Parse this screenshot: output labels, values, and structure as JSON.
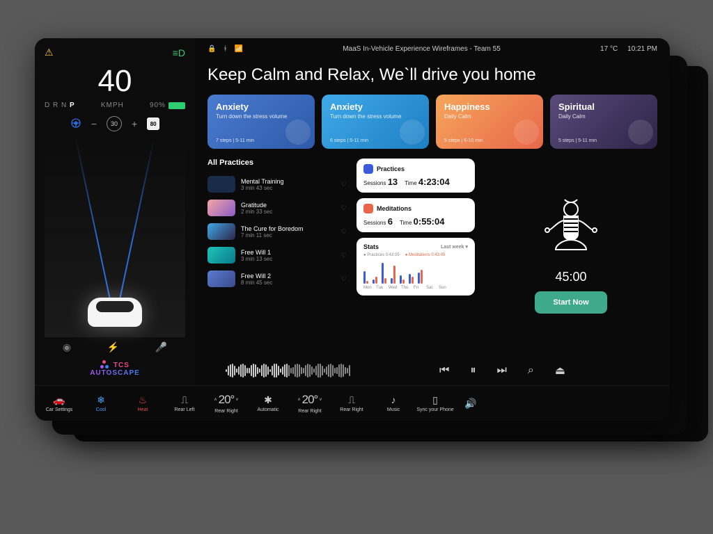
{
  "status": {
    "title": "MaaS  In-Vehicle Experience Wireframes - Team 55",
    "temp": "17 °C",
    "time": "10:21 PM",
    "time2": "10:21 PM",
    "time3": "21 PM"
  },
  "cluster": {
    "speed": "40",
    "speed_unit": "KMPH",
    "gear": {
      "d": "D",
      "r": "R",
      "n": "N",
      "p": "P"
    },
    "battery": "90%",
    "cruise_set": "30",
    "speed_limit": "80",
    "brand1": "TCS",
    "brand2": "AUTOSCAPE"
  },
  "hero": "Keep Calm and Relax, We`ll drive you home",
  "cards": [
    {
      "title": "Anxiety",
      "sub": "Turn down the stress volume",
      "meta": "7 steps   |   5-11 min"
    },
    {
      "title": "Anxiety",
      "sub": "Turn down the stress volume",
      "meta": "6 steps   |   5-11 min"
    },
    {
      "title": "Happiness",
      "sub": "Daily Calm",
      "meta": "5 steps   |   6-10 min"
    },
    {
      "title": "Spiritual",
      "sub": "Daily Calm",
      "meta": "5 steps   |   5-11 min"
    }
  ],
  "practices_title": "All Practices",
  "practices": [
    {
      "name": "Mental Training",
      "time": "3 min 43 sec",
      "color": "#1a2b4a"
    },
    {
      "name": "Gratitude",
      "time": "2 min 33 sec",
      "color": "linear-gradient(135deg,#f5a6a6,#8a5ac4)"
    },
    {
      "name": "The Cure for Boredom",
      "time": "7 min 11 sec",
      "color": "linear-gradient(135deg,#3fa9e8,#2d2448)"
    },
    {
      "name": "Free Will 1",
      "time": "3 min 13 sec",
      "color": "linear-gradient(135deg,#1ec4b8,#0a7a8a)"
    },
    {
      "name": "Free Will 2",
      "time": "8 min 45 sec",
      "color": "linear-gradient(135deg,#5a7bcf,#3a4a8a)"
    }
  ],
  "stats": {
    "practices": {
      "label": "Practices",
      "sessions_label": "Sessions",
      "sessions": "13",
      "time_label": "Time",
      "time": "4:23:04"
    },
    "meditations": {
      "label": "Meditations",
      "sessions_label": "Sessions",
      "sessions": "6",
      "time_label": "Time",
      "time": "0:55:04"
    },
    "stats_label": "Stats",
    "period": "Last week ▾",
    "legend_p": "Practices",
    "legend_m": "Meditations",
    "legend_pv": "0:43:05",
    "legend_mv": "0:43:05",
    "days": [
      "Mon",
      "Tue",
      "Wed",
      "Thu",
      "Fri",
      "Sat",
      "Sun"
    ]
  },
  "timer": {
    "value": "45:00",
    "start": "Start Now"
  },
  "bottombar": {
    "car_settings": "Car Settings",
    "cool": "Cool",
    "heat": "Heat",
    "rear_left": "Rear Left",
    "rear_right": "Rear Right",
    "automatic": "Automatic",
    "music": "Music",
    "sync": "Sync your Phone",
    "temp": "20°"
  },
  "chart_data": {
    "type": "bar",
    "categories": [
      "Mon",
      "Tue",
      "Wed",
      "Thu",
      "Fri",
      "Sat",
      "Sun"
    ],
    "series": [
      {
        "name": "Practices",
        "values": [
          18,
          6,
          30,
          8,
          12,
          14,
          16
        ]
      },
      {
        "name": "Meditations",
        "values": [
          4,
          10,
          8,
          26,
          6,
          10,
          20
        ]
      }
    ],
    "title": "Stats",
    "ylim": [
      0,
      35
    ]
  }
}
